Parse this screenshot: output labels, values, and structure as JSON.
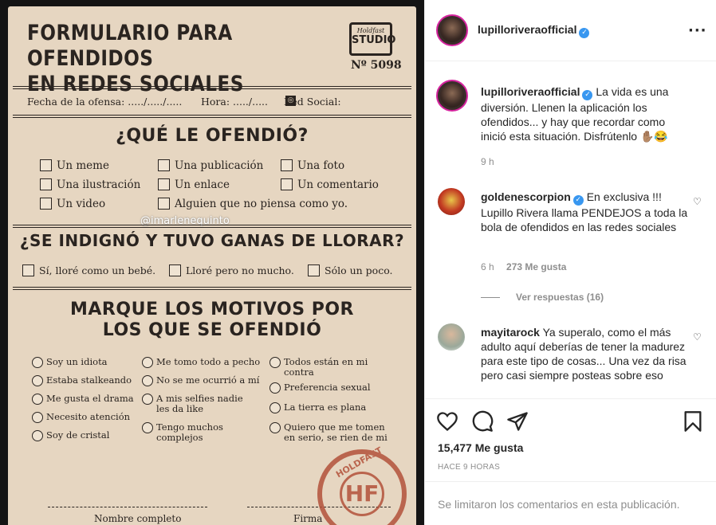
{
  "form": {
    "title_line1": "FORMULARIO PARA OFENDIDOS",
    "title_line2": "EN REDES SOCIALES",
    "studio_small": "Holdfast",
    "studio_big": "STUDIO",
    "number": "Nº 5098",
    "fecha": "Fecha de la ofensa: ...../...../.....",
    "hora": "Hora: ...../.....",
    "red_social": "Red Social:",
    "section1_title": "¿QUÉ LE OFENDIÓ?",
    "section1_options": [
      "Un meme",
      "Una publicación",
      "Una foto",
      "Una ilustración",
      "Un enlace",
      "Un comentario",
      "Un video",
      "Alguien que no piensa como yo."
    ],
    "watermark": "@imarlenequinto",
    "section2_title": "¿SE INDIGNÓ Y TUVO GANAS DE LLORAR?",
    "section2_options": [
      "Sí, lloré como un bebé.",
      "Lloré pero no mucho.",
      "Sólo un poco."
    ],
    "section3_title_line1": "MARQUE LOS MOTIVOS POR",
    "section3_title_line2": "LOS QUE SE OFENDIÓ",
    "motivos": [
      "Soy un idiota",
      "Estaba stalkeando",
      "Me gusta el drama",
      "Necesito atención",
      "Soy de cristal",
      "Me tomo todo a pecho",
      "No se me ocurrió a mí",
      "A mis selfies nadie les da like",
      "Tengo muchos complejos",
      "Todos están en mi contra",
      "Preferencia sexual",
      "La tierra es plana",
      "Quiero que me tomen en serio, se rien de mi"
    ],
    "stamp_text": "HOLDFAST",
    "stamp_logo": "HF",
    "nombre": "Nombre completo",
    "firma": "Firma"
  },
  "post": {
    "username": "lupilloriveraofficial",
    "caption": "La vida es una diversión. Llenen la aplicación los ofendidos... y hay que recordar como inició esta situación. Disfrútenlo ✋🏽😂",
    "caption_time": "9 h",
    "comments": [
      {
        "username": "goldenescorpion",
        "text": "En exclusiva !!! Lupillo Rivera llama PENDEJOS a toda la bola de ofendidos en las redes sociales",
        "time": "6 h",
        "likes": "273 Me gusta",
        "replies": "Ver respuestas (16)"
      },
      {
        "username": "mayitarock",
        "text": "Ya superalo, como el más adulto aquí deberías de tener la madurez para este tipo de cosas... Una vez da risa pero casi siempre posteas sobre eso"
      }
    ],
    "likes": "15,477 Me gusta",
    "ago": "HACE 9 HORAS",
    "comments_limited": "Se limitaron los comentarios en esta publicación."
  },
  "colors": {
    "paper": "#e6d6c1",
    "ink": "#2a2420",
    "stamp": "#b3523a",
    "verified": "#3897f0",
    "muted": "#8e8e8e"
  },
  "icons": [
    "more-options-icon",
    "heart-icon",
    "comment-icon",
    "share-icon",
    "bookmark-icon",
    "verified-icon"
  ]
}
